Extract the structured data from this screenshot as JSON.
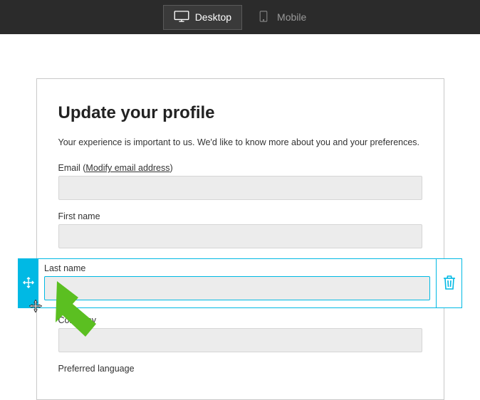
{
  "topbar": {
    "desktop_label": "Desktop",
    "mobile_label": "Mobile"
  },
  "form": {
    "title": "Update your profile",
    "description": "Your experience is important to us. We'd like to know more about you and your preferences.",
    "email_label": "Email",
    "email_link_text": "Modify email address",
    "first_name_label": "First name",
    "last_name_label": "Last name",
    "company_label": "Company",
    "preferred_language_label": "Preferred language"
  }
}
